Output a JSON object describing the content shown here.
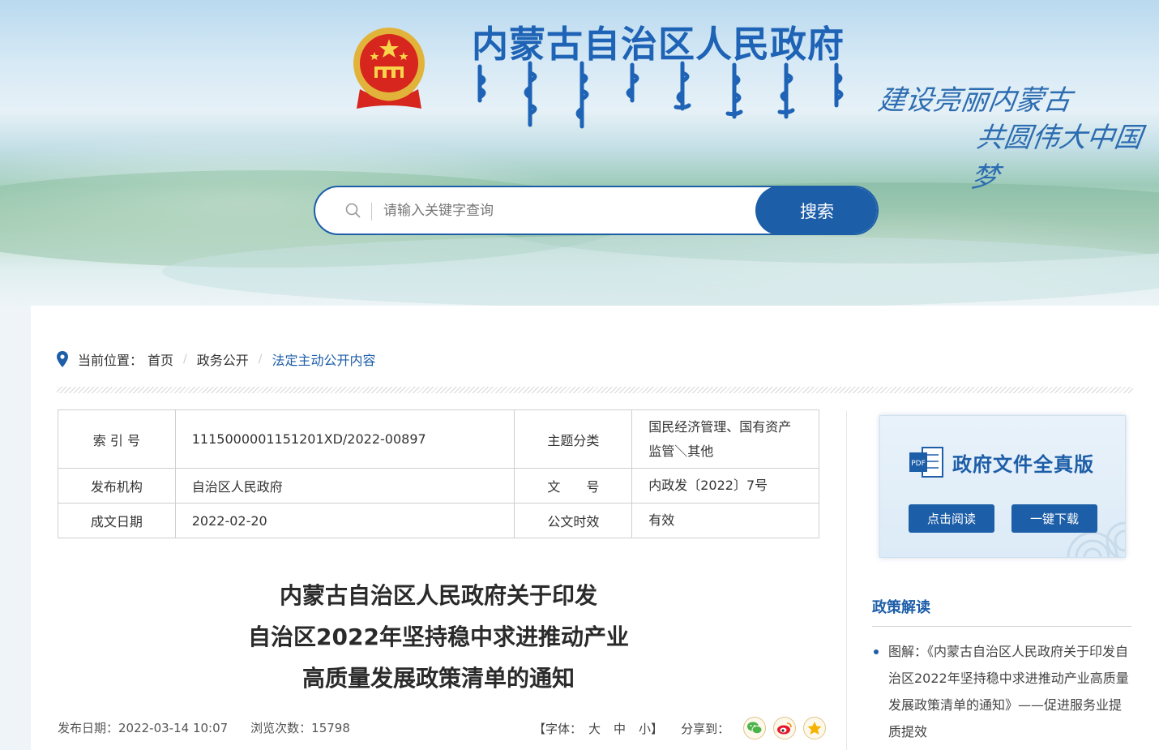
{
  "header": {
    "site_title": "内蒙古自治区人民政府",
    "slogan_line1": "建设亮丽内蒙古",
    "slogan_line2": "共圆伟大中国梦"
  },
  "search": {
    "placeholder": "请输入关键字查询",
    "button_label": "搜索"
  },
  "breadcrumb": {
    "label": "当前位置：",
    "items": [
      "首页",
      "政务公开",
      "法定主动公开内容"
    ]
  },
  "meta": {
    "index_no_label": "索 引 号",
    "index_no_value": "1115000001151201XD/2022-00897",
    "topic_label": "主题分类",
    "topic_value": "国民经济管理、国有资产监管＼其他",
    "issuer_label": "发布机构",
    "issuer_value": "自治区人民政府",
    "doc_no_label": "文　　号",
    "doc_no_value": "内政发〔2022〕7号",
    "date_label": "成文日期",
    "date_value": "2022-02-20",
    "validity_label": "公文时效",
    "validity_value": "有效"
  },
  "article": {
    "title_lines": [
      "内蒙古自治区人民政府关于印发",
      "自治区2022年坚持稳中求进推动产业",
      "高质量发展政策清单的通知"
    ],
    "publish_date": "发布日期：2022-03-14 10:07",
    "views": "浏览次数：15798",
    "font_label_open": "【字体：",
    "font_large": "大",
    "font_medium": "中",
    "font_small": "小】",
    "share_label": "分享到："
  },
  "sidebar": {
    "fulltext_title": "政府文件全真版",
    "read_button": "点击阅读",
    "download_button": "一键下载",
    "policy_heading": "政策解读",
    "policy_items": [
      "图解：《内蒙古自治区人民政府关于印发自治区2022年坚持稳中求进推动产业高质量发展政策清单的通知》——促进服务业提质提效"
    ]
  },
  "colors": {
    "brand_blue": "#1d5ea8",
    "title_blue": "#1e63b5"
  },
  "icons": {
    "emblem": "national-emblem-icon",
    "search": "search-icon",
    "location": "location-pin-icon",
    "word_doc": "word-document-icon",
    "wechat": "wechat-icon",
    "weibo": "weibo-icon",
    "qzone": "qzone-icon"
  }
}
